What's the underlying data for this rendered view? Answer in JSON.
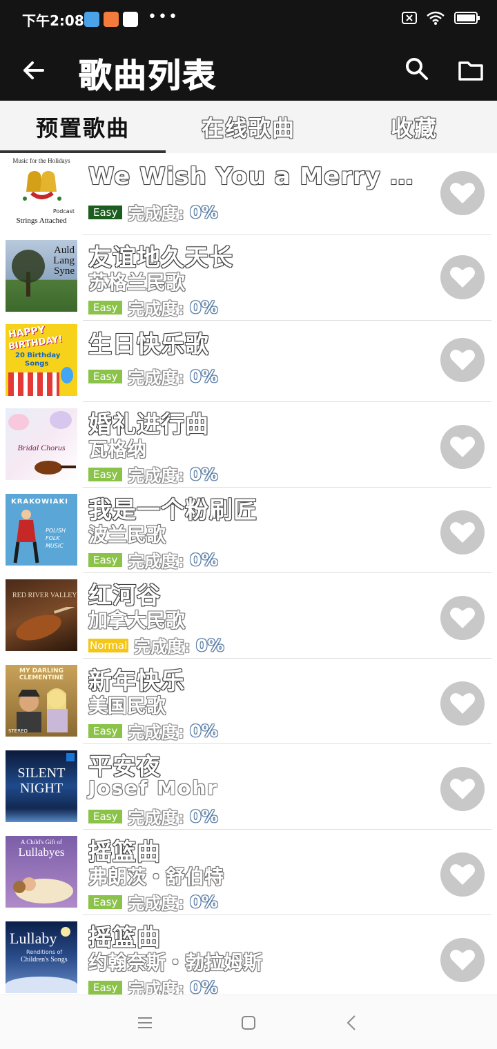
{
  "status_bar": {
    "time": "下午2:08",
    "dots": "•••"
  },
  "app_bar": {
    "title": "歌曲列表"
  },
  "tabs": [
    {
      "label": "预置歌曲",
      "active": true
    },
    {
      "label": "在线歌曲",
      "active": false
    },
    {
      "label": "收藏",
      "active": false
    }
  ],
  "progress_label": "完成度:",
  "songs": [
    {
      "name": "We Wish You a Merry C…",
      "artist": "",
      "difficulty": "Easy",
      "progress": "0%",
      "cover": "holidays"
    },
    {
      "name": "友谊地久天长",
      "artist": "苏格兰民歌",
      "difficulty": "Easy",
      "progress": "0%",
      "cover": "auld-lang-syne"
    },
    {
      "name": "生日快乐歌",
      "artist": "",
      "difficulty": "Easy",
      "progress": "0%",
      "cover": "birthday"
    },
    {
      "name": "婚礼进行曲",
      "artist": "瓦格纳",
      "difficulty": "Easy",
      "progress": "0%",
      "cover": "bridal"
    },
    {
      "name": "我是一个粉刷匠",
      "artist": "波兰民歌",
      "difficulty": "Easy",
      "progress": "0%",
      "cover": "krakowiaki"
    },
    {
      "name": "红河谷",
      "artist": "加拿大民歌",
      "difficulty": "Normal",
      "progress": "0%",
      "cover": "red-river"
    },
    {
      "name": "新年快乐",
      "artist": "美国民歌",
      "difficulty": "Easy",
      "progress": "0%",
      "cover": "clementine"
    },
    {
      "name": "平安夜",
      "artist": "Josef Mohr",
      "difficulty": "Easy",
      "progress": "0%",
      "cover": "silent-night"
    },
    {
      "name": "摇篮曲",
      "artist": "弗朗茨・舒伯特",
      "difficulty": "Easy",
      "progress": "0%",
      "cover": "lullabyes"
    },
    {
      "name": "摇篮曲",
      "artist": "约翰奈斯・勃拉姆斯",
      "difficulty": "Easy",
      "progress": "0%",
      "cover": "lullaby"
    }
  ],
  "covers": {
    "holidays": {
      "top": "Music for the Holidays",
      "mid": "Podcast",
      "bottom": "Strings Attached"
    },
    "auld": {
      "l1": "Auld",
      "l2": "Lang",
      "l3": "Syne"
    },
    "birthday": {
      "l1": "HAPPY",
      "l2": "BIRTHDAY!",
      "l3": "20 Birthday",
      "l4": "Songs"
    },
    "bridal": {
      "l1": "Bridal Chorus"
    },
    "krakowiaki": {
      "l1": "KRAKOWIAKI",
      "l2": "POLISH",
      "l3": "FOLK",
      "l4": "MUSIC"
    },
    "redriver": {
      "l1": "RED RIVER VALLEY"
    },
    "clementine": {
      "l1": "MY DARLING CLEMENTINE",
      "l2": "STEREO"
    },
    "silent": {
      "l1": "SILENT",
      "l2": "NIGHT"
    },
    "lullabyes": {
      "l1": "A Child's Gift of",
      "l2": "Lullabyes"
    },
    "lullaby": {
      "l1": "Lullaby",
      "l2": "Renditions of",
      "l3": "Children's Songs"
    }
  },
  "colors": {
    "bar": "#141414",
    "easy": "#8bc34a",
    "easy_dark": "#1b5e20",
    "normal": "#f5c518",
    "heart_bg": "#c8c8c8"
  }
}
